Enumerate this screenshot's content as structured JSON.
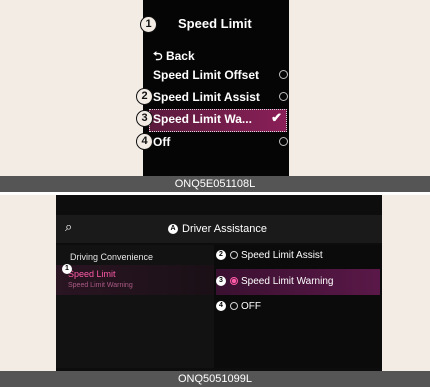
{
  "panel1": {
    "title": "Speed Limit",
    "items": [
      {
        "label": "⮌ Back"
      },
      {
        "label": "Speed Limit Offset"
      },
      {
        "label": "Speed Limit Assist"
      },
      {
        "label": "Speed Limit Wa..."
      },
      {
        "label": "Off"
      }
    ],
    "check": "✔",
    "callouts": [
      "1",
      "2",
      "3",
      "4"
    ],
    "caption": "ONQ5E051108L"
  },
  "panel2": {
    "search_icon": "⌕",
    "header": "Driver Assistance",
    "header_mark": "A",
    "left": {
      "category": "Driving Convenience",
      "selected_title": "Speed Limit",
      "selected_sub": "Speed Limit Warning"
    },
    "options": [
      {
        "mark": "2",
        "label": "Speed Limit Assist"
      },
      {
        "mark": "3",
        "label": "Speed Limit Warning"
      },
      {
        "mark": "4",
        "label": "OFF"
      }
    ],
    "left_mark": "1",
    "caption": "ONQ5051099L",
    "colors": {
      "accent": "#ff5aa8",
      "selected_bg": "#8a1f58"
    }
  }
}
